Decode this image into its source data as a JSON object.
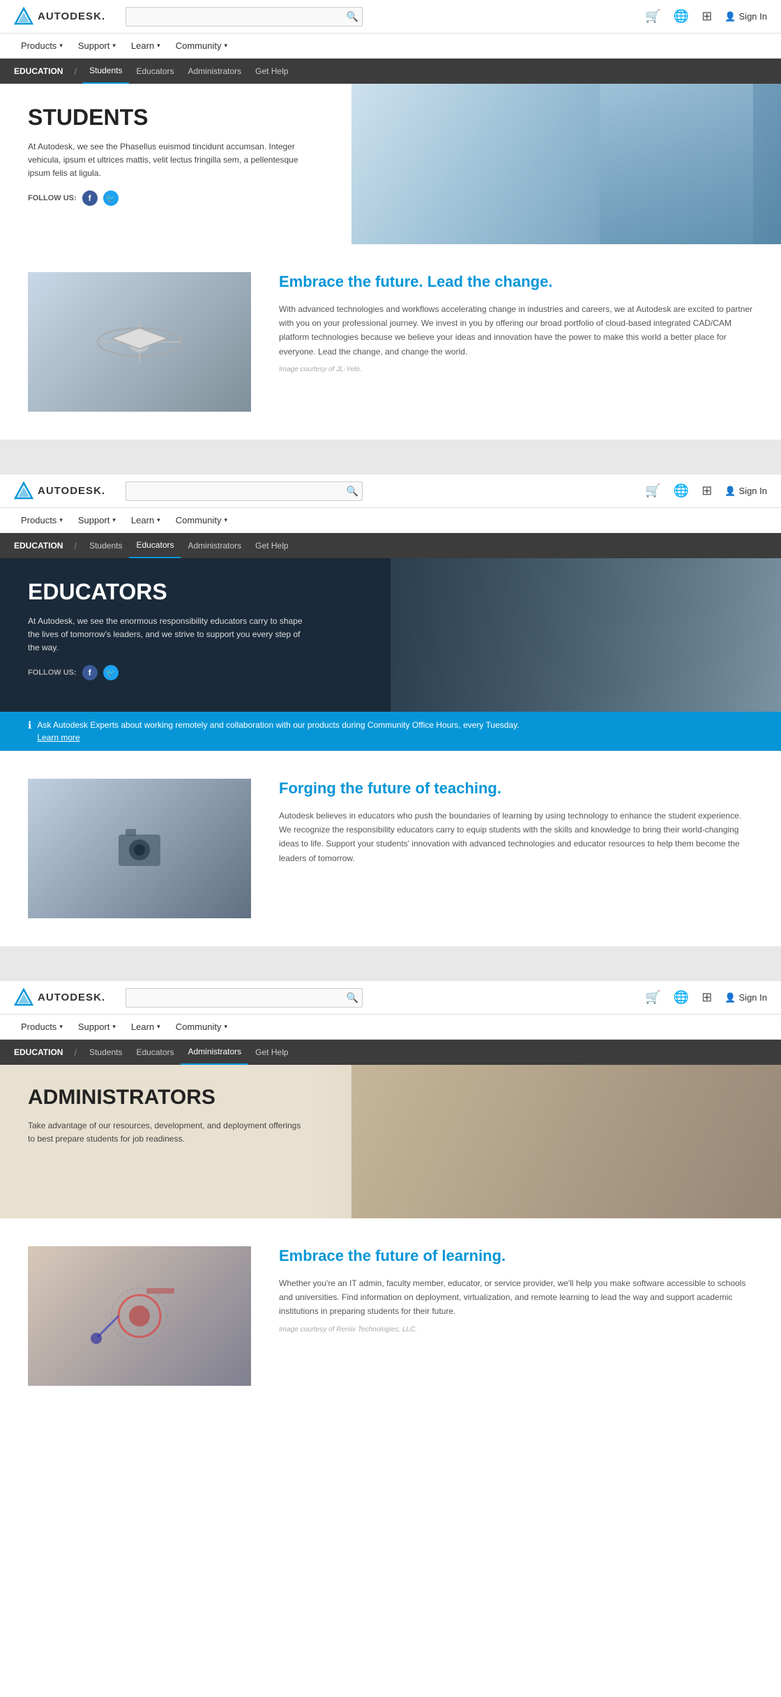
{
  "sections": [
    {
      "id": "students",
      "header": {
        "logo": "AUTODESK.",
        "search_placeholder": "",
        "cart_icon": "🛒",
        "globe_icon": "🌐",
        "grid_icon": "⊞",
        "sign_in": "Sign In",
        "nav": [
          {
            "label": "Products",
            "has_arrow": true
          },
          {
            "label": "Support",
            "has_arrow": true
          },
          {
            "label": "Learn",
            "has_arrow": true
          },
          {
            "label": "Community",
            "has_arrow": true
          }
        ],
        "edu_bar": {
          "title": "EDUCATION",
          "sep": "/",
          "links": [
            {
              "label": "Students",
              "active": true
            },
            {
              "label": "Educators",
              "active": false
            },
            {
              "label": "Administrators",
              "active": false
            },
            {
              "label": "Get Help",
              "active": false
            }
          ]
        }
      },
      "hero": {
        "title": "STUDENTS",
        "desc": "At Autodesk, we see the Phasellus euismod tincidunt accumsan. Integer vehicula, ipsum et ultrices mattis, velit lectus fringilla sem, a pellentesque ipsum felis at ligula.",
        "follow_us": "FOLLOW US:"
      },
      "feature": {
        "title": "Embrace the future. Lead the change.",
        "desc": "With advanced technologies and workflows accelerating change in industries and careers, we at Autodesk are excited to partner with you on your professional journey. We invest in you by offering our broad portfolio of cloud-based integrated CAD/CAM platform technologies because we believe your ideas and innovation have the power to make this world a better place for everyone. Lead the change, and change the world.",
        "credit": "Image courtesy of JL-Yelo."
      }
    },
    {
      "id": "educators",
      "header": {
        "logo": "AUTODESK.",
        "sign_in": "Sign In",
        "nav": [
          {
            "label": "Products",
            "has_arrow": true
          },
          {
            "label": "Support",
            "has_arrow": true
          },
          {
            "label": "Learn",
            "has_arrow": true
          },
          {
            "label": "Community",
            "has_arrow": true
          }
        ],
        "edu_bar": {
          "title": "EDUCATION",
          "sep": "/",
          "links": [
            {
              "label": "Students",
              "active": false
            },
            {
              "label": "Educators",
              "active": true
            },
            {
              "label": "Administrators",
              "active": false
            },
            {
              "label": "Get Help",
              "active": false
            }
          ]
        }
      },
      "hero": {
        "title": "EDUCATORS",
        "desc": "At Autodesk, we see the enormous responsibility educators carry to shape the lives of tomorrow's leaders, and we strive to support you every step of the way.",
        "follow_us": "FOLLOW US:"
      },
      "alert": {
        "text": "Ask Autodesk Experts about working remotely and collaboration with our products during Community Office Hours, every Tuesday.",
        "link": "Learn more"
      },
      "feature": {
        "title": "Forging the future of teaching.",
        "desc": "Autodesk believes in educators who push the boundaries of learning by using technology to enhance the student experience. We recognize the responsibility educators carry to equip students with the skills and knowledge to bring their world-changing ideas to life. Support your students' innovation with advanced technologies and educator resources to help them become the leaders of tomorrow."
      }
    },
    {
      "id": "administrators",
      "header": {
        "logo": "AUTODESK.",
        "sign_in": "Sign In",
        "nav": [
          {
            "label": "Products",
            "has_arrow": true
          },
          {
            "label": "Support",
            "has_arrow": true
          },
          {
            "label": "Learn",
            "has_arrow": true
          },
          {
            "label": "Community",
            "has_arrow": true
          }
        ],
        "edu_bar": {
          "title": "EDUCATION",
          "sep": "/",
          "links": [
            {
              "label": "Students",
              "active": false
            },
            {
              "label": "Educators",
              "active": false
            },
            {
              "label": "Administrators",
              "active": true
            },
            {
              "label": "Get Help",
              "active": false
            }
          ]
        }
      },
      "hero": {
        "title": "ADMINISTRATORS",
        "desc": "Take advantage of our resources, development, and deployment offerings to best prepare students for job readiness."
      },
      "feature": {
        "title": "Embrace the future of learning.",
        "desc": "Whether you're an IT admin, faculty member, educator, or service provider, we'll help you make software accessible to schools and universities. Find information on deployment, virtualization, and remote learning to lead the way and support academic institutions in preparing students for their future.",
        "credit": "Image courtesy of Reniix Technologies, LLC."
      }
    }
  ]
}
